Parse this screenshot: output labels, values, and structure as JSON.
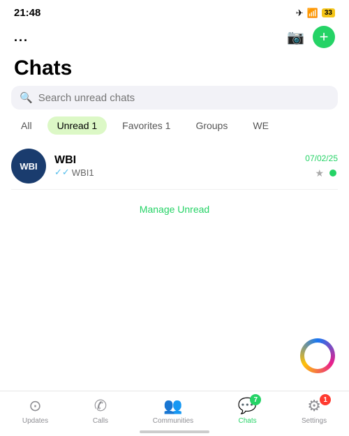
{
  "statusBar": {
    "time": "21:48",
    "batteryBadge": "33"
  },
  "header": {
    "dotsLabel": "...",
    "addButtonLabel": "+",
    "pageTitle": "Chats"
  },
  "search": {
    "placeholder": "Search unread chats"
  },
  "filterTabs": [
    {
      "label": "All",
      "id": "all",
      "active": false
    },
    {
      "label": "Unread",
      "id": "unread",
      "active": true,
      "count": "1"
    },
    {
      "label": "Favorites",
      "id": "favorites",
      "active": false,
      "count": "1"
    },
    {
      "label": "Groups",
      "id": "groups",
      "active": false
    },
    {
      "label": "WE",
      "id": "we",
      "active": false
    }
  ],
  "chats": [
    {
      "id": "wbi",
      "avatarText": "WBI",
      "name": "WBI",
      "preview": "WBI1",
      "date": "07/02/25",
      "hasCheck": true
    }
  ],
  "manageUnread": "Manage Unread",
  "bottomNav": [
    {
      "id": "updates",
      "label": "Updates",
      "icon": "⊙",
      "active": false
    },
    {
      "id": "calls",
      "label": "Calls",
      "icon": "✆",
      "active": false
    },
    {
      "id": "communities",
      "label": "Communities",
      "icon": "👥",
      "active": false
    },
    {
      "id": "chats",
      "label": "Chats",
      "icon": "💬",
      "active": true,
      "badge": "7"
    },
    {
      "id": "settings",
      "label": "Settings",
      "icon": "⚙",
      "active": false,
      "badgeSettings": "1"
    }
  ]
}
